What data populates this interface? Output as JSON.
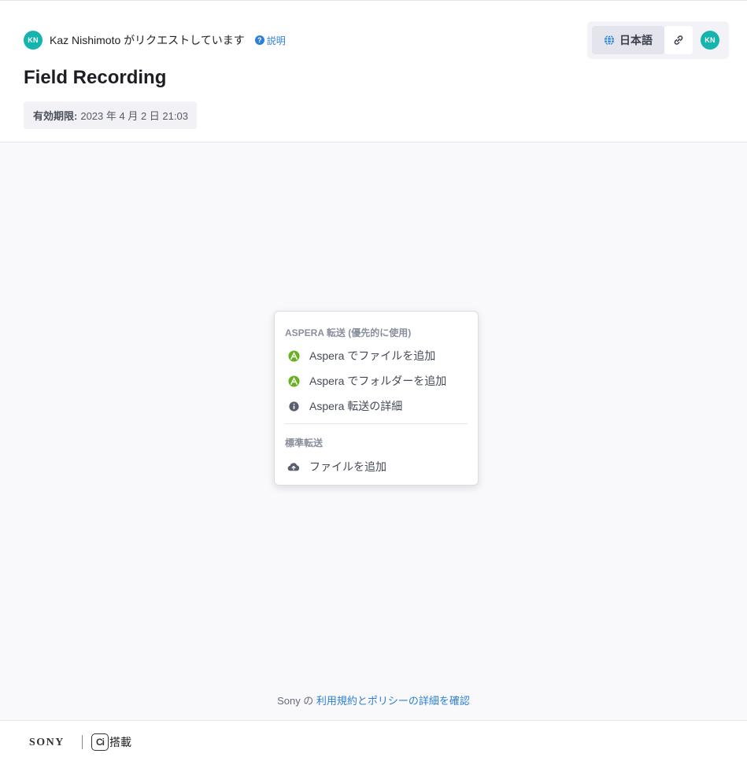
{
  "header": {
    "requester_initials": "KN",
    "requester_text": "Kaz Nishimoto がリクエストしています",
    "help_label": "説明",
    "title": "Field Recording",
    "expiry_label": "有効期限:",
    "expiry_value": "2023 年 4 月 2 日 21:03",
    "language_label": "日本語",
    "user_initials": "KN"
  },
  "upload_menu": {
    "aspera_section": "ASPERA 転送 (優先的に使用)",
    "aspera_add_files": "Aspera でファイルを追加",
    "aspera_add_folder": "Aspera でフォルダーを追加",
    "aspera_details": "Aspera 転送の詳細",
    "standard_section": "標準転送",
    "standard_add_files": "ファイルを追加"
  },
  "terms": {
    "prefix": "Sony の ",
    "link": "利用規約とポリシーの詳細を確認"
  },
  "footer": {
    "brand": "SONY",
    "ci_mark": "Ci",
    "ci_suffix": "搭載"
  },
  "colors": {
    "accent": "#15b4ad",
    "link": "#2d7fd3",
    "aspera_green": "#6ab023"
  }
}
